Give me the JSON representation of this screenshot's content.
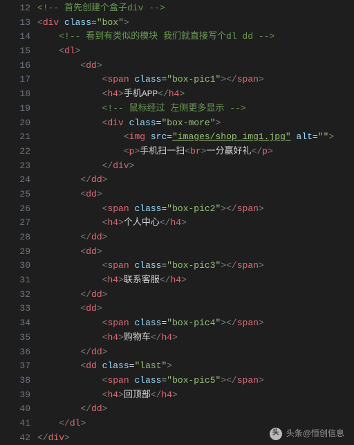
{
  "gutter": {
    "start": 12,
    "end": 42
  },
  "footer": {
    "prefix": "头条",
    "at": "@",
    "name": "恒创信息"
  },
  "lines": [
    [
      [
        "cm",
        "<!-- 首先创建个盒子div -->"
      ]
    ],
    [
      [
        "tg",
        "<"
      ],
      [
        "el",
        "div"
      ],
      [
        "tx",
        " "
      ],
      [
        "at",
        "class"
      ],
      [
        "eq",
        "="
      ],
      [
        "st",
        "\"box\""
      ],
      [
        "tg",
        ">"
      ]
    ],
    [
      [
        "tx",
        "    "
      ],
      [
        "cm",
        "<!-- 看到有类似的模块 我们就直接写个dl dd -->"
      ]
    ],
    [
      [
        "tx",
        "    "
      ],
      [
        "tg",
        "<"
      ],
      [
        "el",
        "dl"
      ],
      [
        "tg",
        ">"
      ]
    ],
    [
      [
        "tx",
        "        "
      ],
      [
        "tg",
        "<"
      ],
      [
        "el",
        "dd"
      ],
      [
        "tg",
        ">"
      ]
    ],
    [
      [
        "tx",
        "            "
      ],
      [
        "tg",
        "<"
      ],
      [
        "el",
        "span"
      ],
      [
        "tx",
        " "
      ],
      [
        "at",
        "class"
      ],
      [
        "eq",
        "="
      ],
      [
        "st",
        "\"box-pic1\""
      ],
      [
        "tg",
        "></"
      ],
      [
        "el",
        "span"
      ],
      [
        "tg",
        ">"
      ]
    ],
    [
      [
        "tx",
        "            "
      ],
      [
        "tg",
        "<"
      ],
      [
        "el",
        "h4"
      ],
      [
        "tg",
        ">"
      ],
      [
        "tx",
        "手机APP"
      ],
      [
        "tg",
        "</"
      ],
      [
        "el",
        "h4"
      ],
      [
        "tg",
        ">"
      ]
    ],
    [
      [
        "tx",
        "            "
      ],
      [
        "cm",
        "<!-- 鼠标经过 左侧更多显示 -->"
      ]
    ],
    [
      [
        "tx",
        "            "
      ],
      [
        "tg",
        "<"
      ],
      [
        "el",
        "div"
      ],
      [
        "tx",
        " "
      ],
      [
        "at",
        "class"
      ],
      [
        "eq",
        "="
      ],
      [
        "st",
        "\"box-more\""
      ],
      [
        "tg",
        ">"
      ]
    ],
    [
      [
        "tx",
        "                "
      ],
      [
        "tg",
        "<"
      ],
      [
        "el",
        "img"
      ],
      [
        "tx",
        " "
      ],
      [
        "at",
        "src"
      ],
      [
        "eq",
        "="
      ],
      [
        "stu",
        "\"images/shop_img1.jpg\""
      ],
      [
        "tx",
        " "
      ],
      [
        "at",
        "alt"
      ],
      [
        "eq",
        "="
      ],
      [
        "st",
        "\"\""
      ],
      [
        "tg",
        ">"
      ]
    ],
    [
      [
        "tx",
        "                "
      ],
      [
        "tg",
        "<"
      ],
      [
        "el",
        "p"
      ],
      [
        "tg",
        ">"
      ],
      [
        "tx",
        "手机扫一扫"
      ],
      [
        "tg",
        "<"
      ],
      [
        "el",
        "br"
      ],
      [
        "tg",
        ">"
      ],
      [
        "tx",
        "一分赢好礼"
      ],
      [
        "tg",
        "</"
      ],
      [
        "el",
        "p"
      ],
      [
        "tg",
        ">"
      ]
    ],
    [
      [
        "tx",
        "            "
      ],
      [
        "tg",
        "</"
      ],
      [
        "el",
        "div"
      ],
      [
        "tg",
        ">"
      ]
    ],
    [
      [
        "tx",
        "        "
      ],
      [
        "tg",
        "</"
      ],
      [
        "el",
        "dd"
      ],
      [
        "tg",
        ">"
      ]
    ],
    [
      [
        "tx",
        "        "
      ],
      [
        "tg",
        "<"
      ],
      [
        "el",
        "dd"
      ],
      [
        "tg",
        ">"
      ]
    ],
    [
      [
        "tx",
        "            "
      ],
      [
        "tg",
        "<"
      ],
      [
        "el",
        "span"
      ],
      [
        "tx",
        " "
      ],
      [
        "at",
        "class"
      ],
      [
        "eq",
        "="
      ],
      [
        "st",
        "\"box-pic2\""
      ],
      [
        "tg",
        "></"
      ],
      [
        "el",
        "span"
      ],
      [
        "tg",
        ">"
      ]
    ],
    [
      [
        "tx",
        "            "
      ],
      [
        "tg",
        "<"
      ],
      [
        "el",
        "h4"
      ],
      [
        "tg",
        ">"
      ],
      [
        "tx",
        "个人中心"
      ],
      [
        "tg",
        "</"
      ],
      [
        "el",
        "h4"
      ],
      [
        "tg",
        ">"
      ]
    ],
    [
      [
        "tx",
        "        "
      ],
      [
        "tg",
        "</"
      ],
      [
        "el",
        "dd"
      ],
      [
        "tg",
        ">"
      ]
    ],
    [
      [
        "tx",
        "        "
      ],
      [
        "tg",
        "<"
      ],
      [
        "el",
        "dd"
      ],
      [
        "tg",
        ">"
      ]
    ],
    [
      [
        "tx",
        "            "
      ],
      [
        "tg",
        "<"
      ],
      [
        "el",
        "span"
      ],
      [
        "tx",
        " "
      ],
      [
        "at",
        "class"
      ],
      [
        "eq",
        "="
      ],
      [
        "st",
        "\"box-pic3\""
      ],
      [
        "tg",
        "></"
      ],
      [
        "el",
        "span"
      ],
      [
        "tg",
        ">"
      ]
    ],
    [
      [
        "tx",
        "            "
      ],
      [
        "tg",
        "<"
      ],
      [
        "el",
        "h4"
      ],
      [
        "tg",
        ">"
      ],
      [
        "tx",
        "联系客服"
      ],
      [
        "tg",
        "</"
      ],
      [
        "el",
        "h4"
      ],
      [
        "tg",
        ">"
      ]
    ],
    [
      [
        "tx",
        "        "
      ],
      [
        "tg",
        "</"
      ],
      [
        "el",
        "dd"
      ],
      [
        "tg",
        ">"
      ]
    ],
    [
      [
        "tx",
        "        "
      ],
      [
        "tg",
        "<"
      ],
      [
        "el",
        "dd"
      ],
      [
        "tg",
        ">"
      ]
    ],
    [
      [
        "tx",
        "            "
      ],
      [
        "tg",
        "<"
      ],
      [
        "el",
        "span"
      ],
      [
        "tx",
        " "
      ],
      [
        "at",
        "class"
      ],
      [
        "eq",
        "="
      ],
      [
        "st",
        "\"box-pic4\""
      ],
      [
        "tg",
        "></"
      ],
      [
        "el",
        "span"
      ],
      [
        "tg",
        ">"
      ]
    ],
    [
      [
        "tx",
        "            "
      ],
      [
        "tg",
        "<"
      ],
      [
        "el",
        "h4"
      ],
      [
        "tg",
        ">"
      ],
      [
        "tx",
        "购物车"
      ],
      [
        "tg",
        "</"
      ],
      [
        "el",
        "h4"
      ],
      [
        "tg",
        ">"
      ]
    ],
    [
      [
        "tx",
        "        "
      ],
      [
        "tg",
        "</"
      ],
      [
        "el",
        "dd"
      ],
      [
        "tg",
        ">"
      ]
    ],
    [
      [
        "tx",
        "        "
      ],
      [
        "tg",
        "<"
      ],
      [
        "el",
        "dd"
      ],
      [
        "tx",
        " "
      ],
      [
        "at",
        "class"
      ],
      [
        "eq",
        "="
      ],
      [
        "st",
        "\"last\""
      ],
      [
        "tg",
        ">"
      ]
    ],
    [
      [
        "tx",
        "            "
      ],
      [
        "tg",
        "<"
      ],
      [
        "el",
        "span"
      ],
      [
        "tx",
        " "
      ],
      [
        "at",
        "class"
      ],
      [
        "eq",
        "="
      ],
      [
        "st",
        "\"box-pic5\""
      ],
      [
        "tg",
        "></"
      ],
      [
        "el",
        "span"
      ],
      [
        "tg",
        ">"
      ]
    ],
    [
      [
        "tx",
        "            "
      ],
      [
        "tg",
        "<"
      ],
      [
        "el",
        "h4"
      ],
      [
        "tg",
        ">"
      ],
      [
        "tx",
        "回顶部"
      ],
      [
        "tg",
        "</"
      ],
      [
        "el",
        "h4"
      ],
      [
        "tg",
        ">"
      ]
    ],
    [
      [
        "tx",
        "        "
      ],
      [
        "tg",
        "</"
      ],
      [
        "el",
        "dd"
      ],
      [
        "tg",
        ">"
      ]
    ],
    [
      [
        "tx",
        "    "
      ],
      [
        "tg",
        "</"
      ],
      [
        "el",
        "dl"
      ],
      [
        "tg",
        ">"
      ]
    ],
    [
      [
        "tg",
        "</"
      ],
      [
        "el",
        "div"
      ],
      [
        "tg",
        ">"
      ]
    ]
  ]
}
